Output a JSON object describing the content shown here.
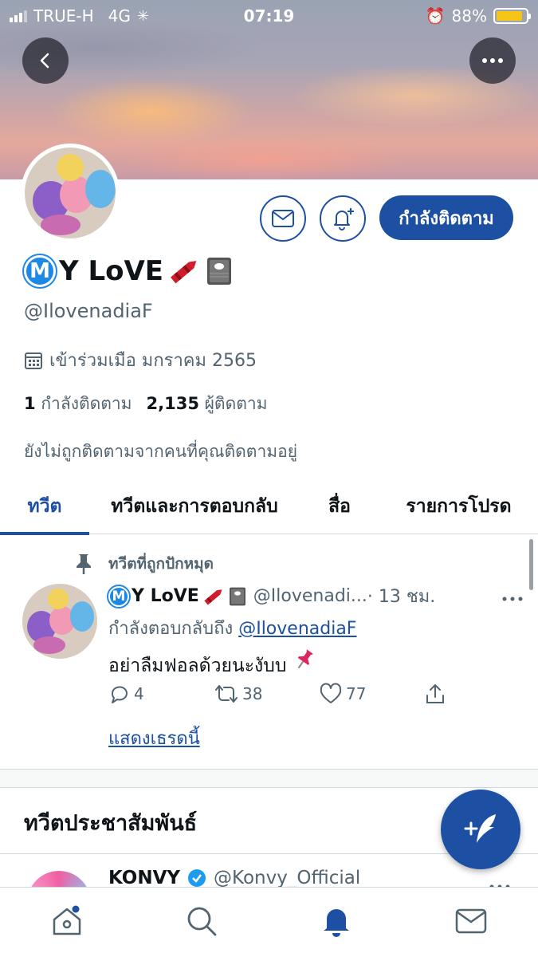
{
  "status_bar": {
    "carrier": "TRUE-H",
    "network": "4G",
    "time": "07:19",
    "battery": "88%",
    "battery_level": 0.88
  },
  "profile": {
    "display_name": "Y LoVE",
    "name_badge": "M",
    "handle": "@IlovenadiaF",
    "joined": "เข้าร่วมเมือ มกราคม 2565",
    "following_count": "1",
    "following_label": "กำลังติดตาม",
    "followers_count": "2,135",
    "followers_label": "ผู้ติดตาม",
    "not_followed_note": "ยังไม่ถูกติดตามจากคนที่คุณติดตามอยู่",
    "follow_button": "กำลังติดตาม"
  },
  "tabs": [
    {
      "label": "ทวีต",
      "active": true
    },
    {
      "label": "ทวีตและการตอบกลับ",
      "active": false
    },
    {
      "label": "สื่อ",
      "active": false
    },
    {
      "label": "รายการโปรด",
      "active": false
    }
  ],
  "pinned_tweet": {
    "pinned_label": "ทวีตที่ถูกปักหมุด",
    "name": "Y LoVE",
    "handle": "@Ilovenadi...",
    "time": "· 13 ชม.",
    "replying_prefix": "กำลังตอบกลับถึง",
    "replying_to": "@IlovenadiaF",
    "text": "อย่าลืมฟอลด้วยนะงับบ",
    "replies": "4",
    "retweets": "38",
    "likes": "77",
    "show_thread": "แสดงเธรดนี้"
  },
  "promoted": {
    "title": "ทวีตประชาสัมพันธ์",
    "account_name": "KONVY",
    "account_handle": "@Konvy_Official"
  },
  "icons": [
    "back-icon",
    "more-icon",
    "mail-icon",
    "bell-plus-icon",
    "calendar-icon",
    "pin-icon",
    "reply-icon",
    "retweet-icon",
    "like-icon",
    "share-icon",
    "compose-icon",
    "home-icon",
    "search-icon",
    "notifications-icon",
    "messages-icon",
    "verified-icon"
  ],
  "colors": {
    "accent": "#1d4fa3",
    "muted": "#536471",
    "verified": "#1d9bf0"
  }
}
